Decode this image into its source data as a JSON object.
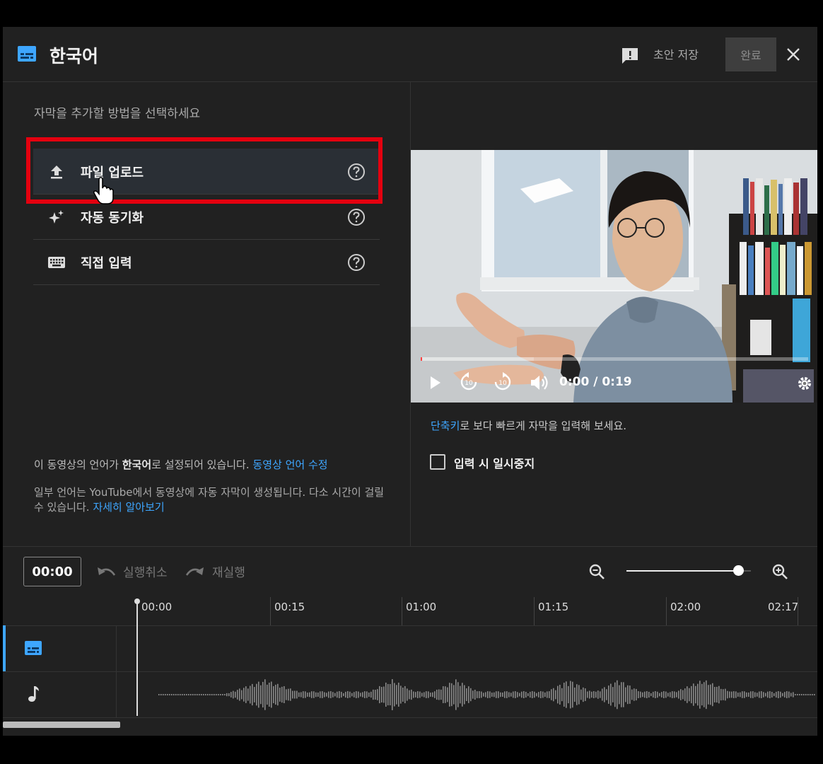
{
  "header": {
    "title": "한국어",
    "feedback_icon": "feedback-icon",
    "draft_label": "초안 저장",
    "done_label": "완료",
    "close_icon": "close-icon"
  },
  "left_panel": {
    "heading": "자막을 추가할 방법을 선택하세요",
    "options": [
      {
        "label": "파일 업로드",
        "icon": "upload-icon"
      },
      {
        "label": "자동 동기화",
        "icon": "sparkle-icon"
      },
      {
        "label": "직접 입력",
        "icon": "keyboard-icon"
      }
    ],
    "lang_note_prefix": "이 동영상의 언어가 ",
    "lang_note_lang": "한국어",
    "lang_note_suffix": "로 설정되어 있습니다. ",
    "lang_note_link": "동영상 언어 수정",
    "auto_note": "일부 언어는 YouTube에서 동영상에 자동 자막이 생성됩니다. 다소 시간이 걸릴 수 있습니다. ",
    "auto_note_link": "자세히 알아보기"
  },
  "player": {
    "time_display": "0:00 / 0:19",
    "progress": 0.0
  },
  "right_panel": {
    "shortcut_link": "단축키",
    "shortcut_text": "로 보다 빠르게 자막을 입력해 보세요.",
    "pause_label": "입력 시 일시중지",
    "pause_checked": false
  },
  "toolbar": {
    "time_value": "00:00",
    "undo_label": "실행취소",
    "redo_label": "재실행",
    "zoom_level": 0.9
  },
  "timeline": {
    "ticks": [
      "00:00",
      "00:15",
      "01:00",
      "01:15",
      "02:00",
      "02:17"
    ]
  },
  "colors": {
    "accent": "#3ea6ff",
    "highlight": "#e4000f",
    "background": "#212121"
  }
}
